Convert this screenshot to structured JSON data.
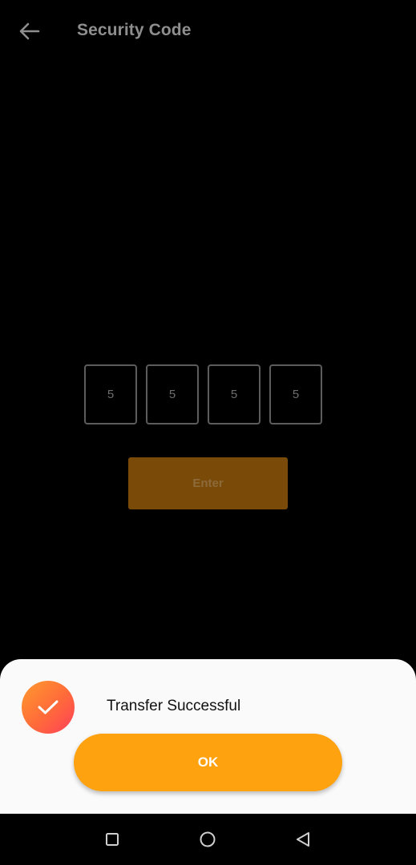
{
  "app_bar": {
    "title": "Security Code",
    "back_icon": "arrow-left-icon"
  },
  "code_inputs": [
    "5",
    "5",
    "5",
    "5"
  ],
  "enter_button": {
    "label": "Enter"
  },
  "success_sheet": {
    "icon": "check-icon",
    "message": "Transfer Successful",
    "ok_label": "OK"
  },
  "nav_bar": {
    "items": [
      "square-recents-icon",
      "circle-home-icon",
      "triangle-back-icon"
    ]
  },
  "colors": {
    "accent": "#ffa20f",
    "enter_dimmed": "#7a4a08",
    "icon_gradient_start": "#ff9a2e",
    "icon_gradient_end": "#ff3f5a"
  }
}
